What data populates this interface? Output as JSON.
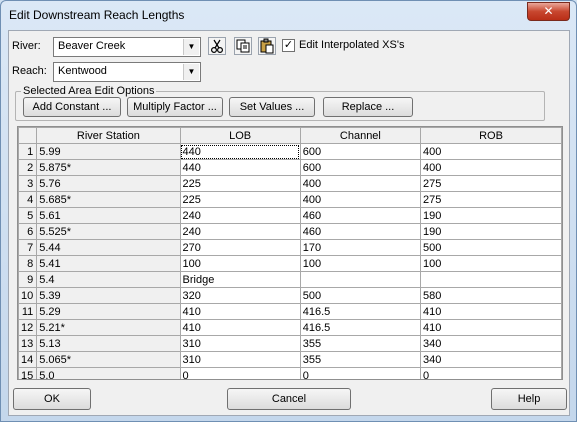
{
  "window": {
    "title": "Edit Downstream Reach Lengths",
    "close_glyph": "✕"
  },
  "river": {
    "label": "River:",
    "value": "Beaver Creek"
  },
  "reach": {
    "label": "Reach:",
    "value": "Kentwood"
  },
  "toolbar": {
    "cut_icon": "scissors-icon",
    "copy_icon": "copy-icon",
    "paste_icon": "paste-icon",
    "edit_interpolated": {
      "label": "Edit Interpolated XS's",
      "checked": true
    }
  },
  "selected_area": {
    "title": "Selected Area Edit Options",
    "add_constant": "Add Constant ...",
    "multiply_factor": "Multiply Factor ...",
    "set_values": "Set Values ...",
    "replace": "Replace ..."
  },
  "table": {
    "headers": [
      "River Station",
      "LOB",
      "Channel",
      "ROB"
    ],
    "rows": [
      {
        "n": "1",
        "station": "5.99",
        "lob": "440",
        "channel": "600",
        "rob": "400"
      },
      {
        "n": "2",
        "station": "5.875*",
        "lob": "440",
        "channel": "600",
        "rob": "400"
      },
      {
        "n": "3",
        "station": "5.76",
        "lob": "225",
        "channel": "400",
        "rob": "275"
      },
      {
        "n": "4",
        "station": "5.685*",
        "lob": "225",
        "channel": "400",
        "rob": "275"
      },
      {
        "n": "5",
        "station": "5.61",
        "lob": "240",
        "channel": "460",
        "rob": "190"
      },
      {
        "n": "6",
        "station": "5.525*",
        "lob": "240",
        "channel": "460",
        "rob": "190"
      },
      {
        "n": "7",
        "station": "5.44",
        "lob": "270",
        "channel": "170",
        "rob": "500"
      },
      {
        "n": "8",
        "station": "5.41",
        "lob": "100",
        "channel": "100",
        "rob": "100"
      },
      {
        "n": "9",
        "station": "5.4",
        "lob": "Bridge",
        "channel": "",
        "rob": ""
      },
      {
        "n": "10",
        "station": "5.39",
        "lob": "320",
        "channel": "500",
        "rob": "580"
      },
      {
        "n": "11",
        "station": "5.29",
        "lob": "410",
        "channel": "416.5",
        "rob": "410"
      },
      {
        "n": "12",
        "station": "5.21*",
        "lob": "410",
        "channel": "416.5",
        "rob": "410"
      },
      {
        "n": "13",
        "station": "5.13",
        "lob": "310",
        "channel": "355",
        "rob": "340"
      },
      {
        "n": "14",
        "station": "5.065*",
        "lob": "310",
        "channel": "355",
        "rob": "340"
      },
      {
        "n": "15",
        "station": "5.0",
        "lob": "0",
        "channel": "0",
        "rob": "0"
      }
    ]
  },
  "buttons": {
    "ok": "OK",
    "cancel": "Cancel",
    "help": "Help"
  }
}
